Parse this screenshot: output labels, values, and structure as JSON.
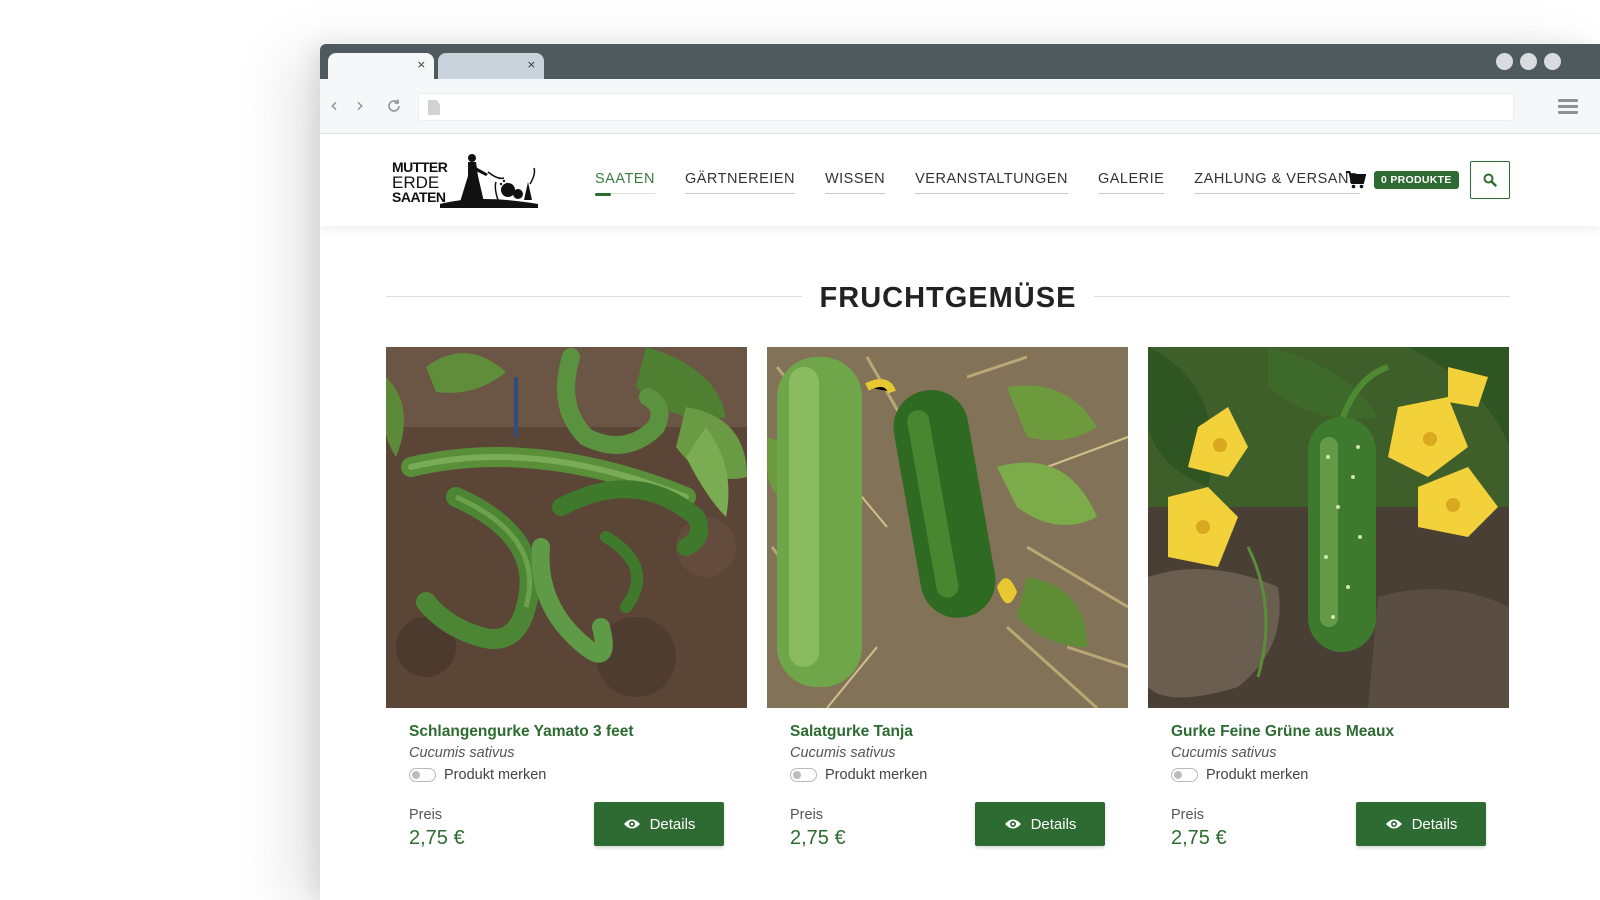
{
  "browser": {
    "tabs": [
      {
        "close": "×"
      },
      {
        "close": "×"
      }
    ]
  },
  "site": {
    "logo": {
      "line1": "MUTTER",
      "line2": "ERDE",
      "line3": "SAATEN"
    },
    "nav": [
      {
        "label": "SAATEN",
        "active": true
      },
      {
        "label": "GÄRTNEREIEN"
      },
      {
        "label": "WISSEN"
      },
      {
        "label": "VERANSTALTUNGEN"
      },
      {
        "label": "GALERIE"
      },
      {
        "label": "ZAHLUNG & VERSAND"
      }
    ],
    "cart": {
      "icon": "cart-icon",
      "badge": "0 PRODUKTE"
    },
    "search": {
      "icon": "search-icon"
    }
  },
  "section": {
    "title": "FRUCHTGEMÜSE"
  },
  "products": [
    {
      "title": "Schlangengurke Yamato 3 feet",
      "latin": "Cucumis sativus",
      "merk": "Produkt merken",
      "price_label": "Preis",
      "price": "2,75 €",
      "button": "Details",
      "image": "Curved snake cucumbers lying on brown soil"
    },
    {
      "title": "Salatgurke Tanja",
      "latin": "Cucumis sativus",
      "merk": "Produkt merken",
      "price_label": "Preis",
      "price": "2,75 €",
      "button": "Details",
      "image": "Two green slicing cucumbers on dry straw and soil"
    },
    {
      "title": "Gurke Feine Grüne aus Meaux",
      "latin": "Cucumis sativus",
      "merk": "Produkt merken",
      "price_label": "Preis",
      "price": "2,75 €",
      "button": "Details",
      "image": "Spiny pickling cucumber with yellow flowers"
    }
  ],
  "colors": {
    "accent": "#2e6b32",
    "tabbar": "#4f5a5e"
  }
}
